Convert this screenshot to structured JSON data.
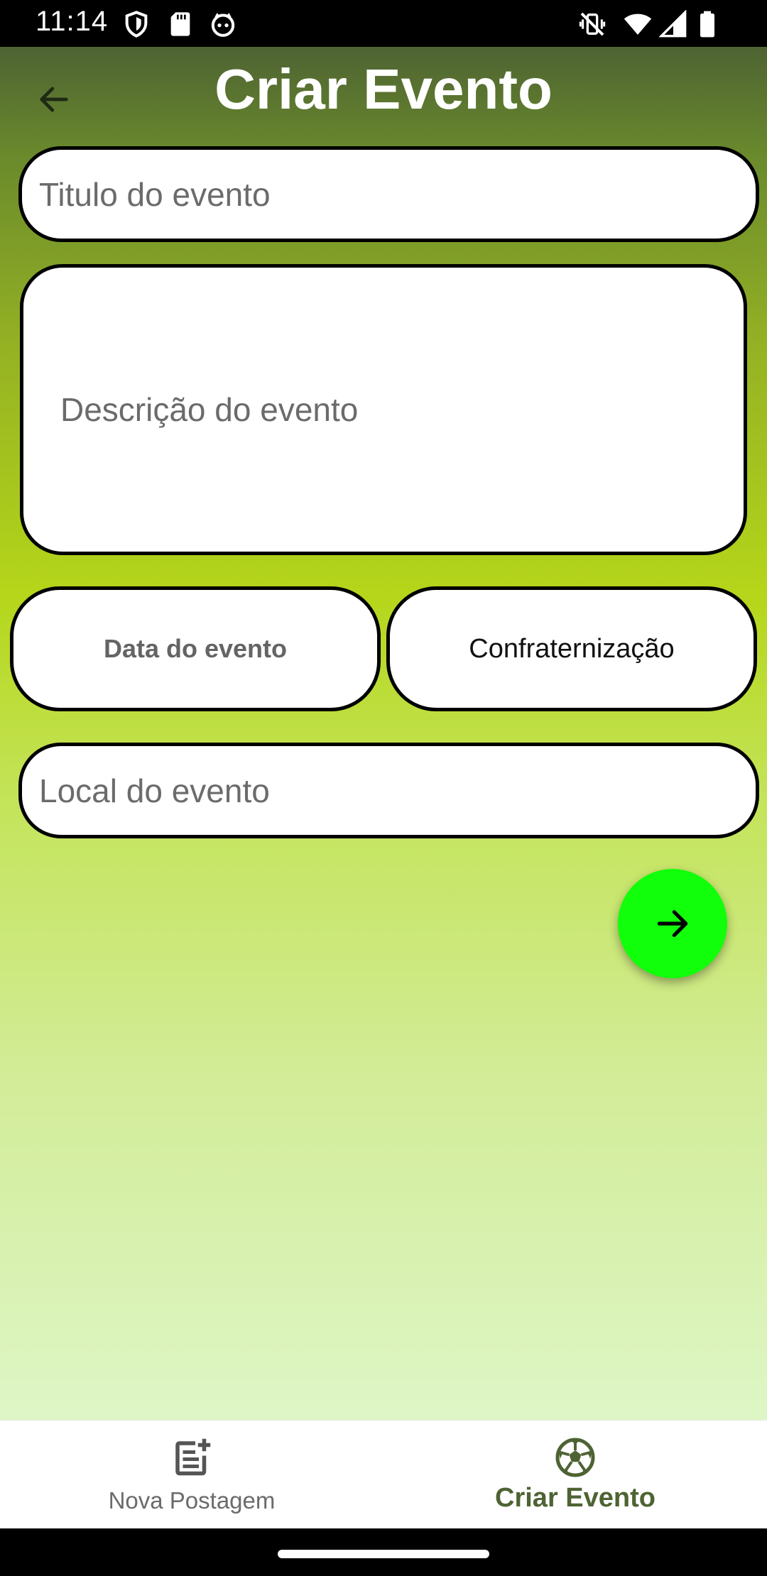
{
  "status_bar": {
    "time": "11:14",
    "left_icons": [
      "shield-icon",
      "sd-card-icon",
      "cat-face-icon"
    ],
    "right_icons": [
      "vibrate-off-icon",
      "wifi-icon",
      "signal-icon",
      "battery-icon"
    ]
  },
  "header": {
    "title": "Criar Evento",
    "back_icon": "arrow-left-icon"
  },
  "form": {
    "title_placeholder": "Titulo do evento",
    "description_placeholder": "Descrição do evento",
    "date_button_label": "Data do evento",
    "type_button_label": "Confraternização",
    "location_placeholder": "Local do evento",
    "submit_icon": "arrow-right-icon"
  },
  "bottom_nav": {
    "items": [
      {
        "label": "Nova Postagem",
        "icon": "post-add-icon",
        "active": false
      },
      {
        "label": "Criar Evento",
        "icon": "soccer-ball-icon",
        "active": true
      }
    ]
  },
  "colors": {
    "fab": "#11ff0a",
    "active_nav": "#4e6333",
    "gradient_top": "#4e6333",
    "gradient_mid": "#b5d61a",
    "gradient_bottom": "#def6c6"
  }
}
